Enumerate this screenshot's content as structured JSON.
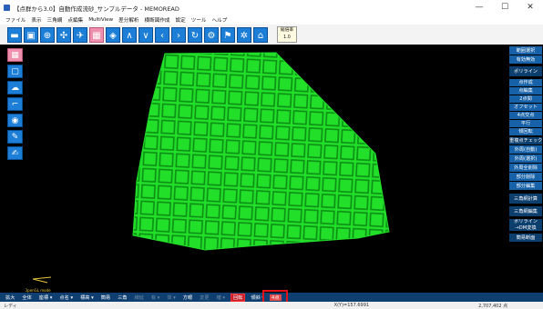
{
  "window": {
    "title": "【点群から3.0】自動作成流砂_サンプルデータ - MEMOREAD",
    "minimize": "—",
    "maximize": "☐",
    "close": "✕"
  },
  "menu": [
    "ファイル",
    "表示",
    "三角網",
    "点編集",
    "MultiView",
    "差分解析",
    "横断図作成",
    "設定",
    "ツール",
    "ヘルプ"
  ],
  "toolbar": {
    "zoom_label": "縮倍率",
    "zoom_value": "1.0"
  },
  "right_panel": {
    "buttons": [
      "範囲選択",
      "有効無効",
      "ポリライン",
      "点作成",
      "点編集",
      "2点間",
      "オフセット",
      "4点交点",
      "平行",
      "傾回転",
      "重複点チェック",
      "外周(自動)",
      "外周(選択)",
      "外周全削除",
      "部分削除",
      "部分編集",
      "三角網計算",
      "三角網編集",
      "ポリライン→DM変換",
      "簡易断面"
    ]
  },
  "bottom_bar": {
    "buttons": [
      "拡大",
      "全体",
      "座標 ▾",
      "点名 ▾",
      "標高 ▾",
      "簡易",
      "三角",
      "線延",
      "有 ▾",
      "体 ▾",
      "方眼",
      "変更",
      "確 ▾",
      "回転",
      "傾斜 ▾",
      "4点"
    ]
  },
  "viewport": {
    "gl_label": "OpenGL mode",
    "surface_color": "#22e02a",
    "grid_color": "#0c8d14"
  },
  "status": {
    "left": "レディ",
    "coord": "X(Y)=157.6991",
    "count": "2,707,402 点"
  }
}
